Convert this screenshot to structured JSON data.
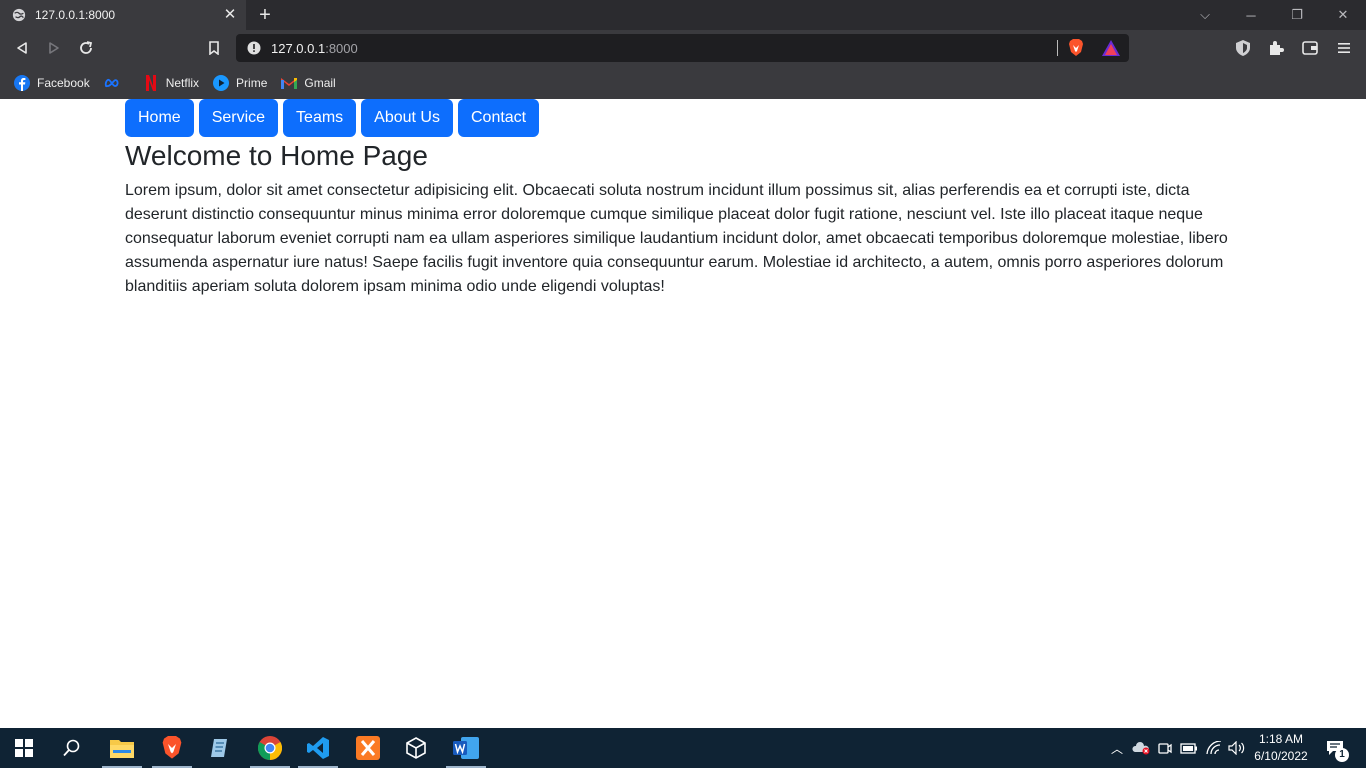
{
  "browser": {
    "tab_title": "127.0.0.1:8000",
    "url_host": "127.0.0.1",
    "url_port": ":8000",
    "bookmarks": [
      {
        "label": "Facebook",
        "icon": "facebook-icon"
      },
      {
        "label": "",
        "icon": "meta-icon"
      },
      {
        "label": "Netflix",
        "icon": "netflix-icon"
      },
      {
        "label": "Prime",
        "icon": "prime-icon"
      },
      {
        "label": "Gmail",
        "icon": "gmail-icon"
      }
    ]
  },
  "page": {
    "nav": [
      "Home",
      "Service",
      "Teams",
      "About Us",
      "Contact"
    ],
    "heading": "Welcome to Home Page",
    "paragraph": "Lorem ipsum, dolor sit amet consectetur adipisicing elit. Obcaecati soluta nostrum incidunt illum possimus sit, alias perferendis ea et corrupti iste, dicta deserunt distinctio consequuntur minus minima error doloremque cumque similique placeat dolor fugit ratione, nesciunt vel. Iste illo placeat itaque neque consequatur laborum eveniet corrupti nam ea ullam asperiores similique laudantium incidunt dolor, amet obcaecati temporibus doloremque molestiae, libero assumenda aspernatur iure natus! Saepe facilis fugit inventore quia consequuntur earum. Molestiae id architecto, a autem, omnis porro asperiores dolorum blanditiis aperiam soluta dolorem ipsam minima odio unde eligendi voluptas!"
  },
  "taskbar": {
    "time": "1:18 AM",
    "date": "6/10/2022",
    "notification_count": "1"
  },
  "colors": {
    "nav_button": "#0d6efd",
    "taskbar": "#0f2334",
    "browser_chrome": "#3a3a3e"
  }
}
